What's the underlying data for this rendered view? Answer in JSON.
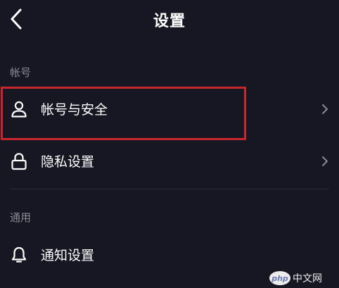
{
  "header": {
    "title": "设置",
    "back_icon": "chevron-left-icon"
  },
  "sections": {
    "account": {
      "label": "帐号",
      "items": [
        {
          "label": "帐号与安全",
          "icon": "user-icon"
        },
        {
          "label": "隐私设置",
          "icon": "lock-icon"
        }
      ]
    },
    "general": {
      "label": "通用",
      "items": [
        {
          "label": "通知设置",
          "icon": "bell-icon"
        }
      ]
    }
  },
  "watermark": {
    "text": "php 中文网"
  },
  "colors": {
    "background": "#161722",
    "section_label": "#8a8b91",
    "highlight_border": "#c8262d"
  }
}
